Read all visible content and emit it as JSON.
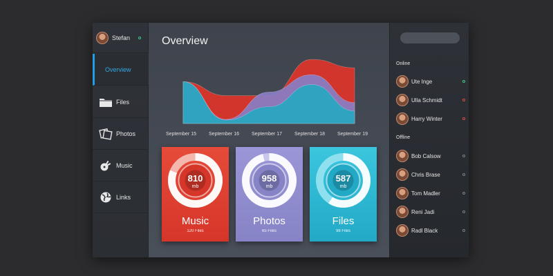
{
  "user": {
    "name": "Stefan",
    "status_color": "#36c88a"
  },
  "nav": [
    {
      "label": "Overview",
      "icon": "overview",
      "active": true
    },
    {
      "label": "Files",
      "icon": "folder-icon",
      "active": false
    },
    {
      "label": "Photos",
      "icon": "photos-icon",
      "active": false
    },
    {
      "label": "Music",
      "icon": "music-icon",
      "active": false
    },
    {
      "label": "Links",
      "icon": "globe-icon",
      "active": false
    }
  ],
  "main": {
    "title": "Overview"
  },
  "chart_data": {
    "type": "area",
    "categories": [
      "September 15",
      "September 16",
      "September 17",
      "September 18",
      "September 19"
    ],
    "ylim": [
      0,
      100
    ],
    "grid": false,
    "series": [
      {
        "color": "#d9352b",
        "values": [
          60,
          40,
          40,
          92,
          80
        ]
      },
      {
        "color": "#8a7ec6",
        "values": [
          60,
          6,
          45,
          70,
          30
        ]
      },
      {
        "color": "#2aa6c0",
        "values": [
          60,
          5,
          24,
          56,
          18
        ]
      }
    ]
  },
  "cards": [
    {
      "value": "810",
      "unit": "mb",
      "label": "Music",
      "sub": "120 Files",
      "fill": 0.81,
      "color_top": "#e64a38",
      "color_bottom": "#d6362a",
      "ring_bg": "#f4b7ae",
      "ring_fg": "#ffffff"
    },
    {
      "value": "958",
      "unit": "mb",
      "label": "Photos",
      "sub": "65 Files",
      "fill": 0.96,
      "color_top": "#9a96d8",
      "color_bottom": "#8684c6",
      "ring_bg": "#c9c6ee",
      "ring_fg": "#ffffff"
    },
    {
      "value": "587",
      "unit": "mb",
      "label": "Files",
      "sub": "98 Files",
      "fill": 0.59,
      "color_top": "#3bc6de",
      "color_bottom": "#22a9c6",
      "ring_bg": "#8fe0ee",
      "ring_fg": "#ffffff"
    }
  ],
  "contacts": {
    "online_label": "Online",
    "offline_label": "Offline",
    "online": [
      {
        "name": "Ute Inge",
        "status_color": "#36c88a"
      },
      {
        "name": "Ulla Schmidt",
        "status_color": "#d84a3a"
      },
      {
        "name": "Harry Winter",
        "status_color": "#d84a3a"
      }
    ],
    "offline": [
      {
        "name": "Bob Calsow",
        "status_color": "#7a7e86"
      },
      {
        "name": "Chris Brase",
        "status_color": "#7a7e86"
      },
      {
        "name": "Tom Madler",
        "status_color": "#7a7e86"
      },
      {
        "name": "Reni Jadi",
        "status_color": "#7a7e86"
      },
      {
        "name": "Radl Black",
        "status_color": "#7a7e86"
      }
    ]
  }
}
